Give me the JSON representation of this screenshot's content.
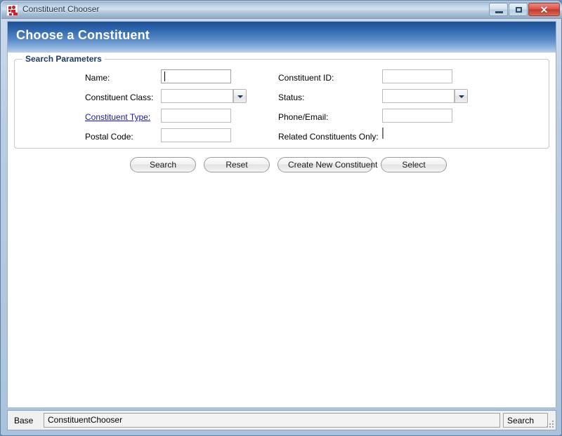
{
  "window": {
    "title": "Constituent Chooser",
    "icon": "app-icon",
    "controls": {
      "minimize": "minimize-icon",
      "maximize": "maximize-icon",
      "close": "✕"
    }
  },
  "header": {
    "title": "Choose a Constituent"
  },
  "group": {
    "legend": "Search Parameters"
  },
  "form": {
    "left": [
      {
        "label": "Name:",
        "type": "text",
        "value": "",
        "focused": true,
        "link": false
      },
      {
        "label": "Constituent Class:",
        "type": "combo",
        "value": "",
        "focused": false,
        "link": false
      },
      {
        "label": "Constituent Type:",
        "type": "text",
        "value": "",
        "focused": false,
        "link": true
      },
      {
        "label": "Postal Code:",
        "type": "text",
        "value": "",
        "focused": false,
        "link": false
      }
    ],
    "right": [
      {
        "label": "Constituent ID:",
        "type": "text",
        "value": "",
        "focused": false,
        "link": false
      },
      {
        "label": "Status:",
        "type": "combo",
        "value": "",
        "focused": false,
        "link": false
      },
      {
        "label": "Phone/Email:",
        "type": "text",
        "value": "",
        "focused": false,
        "link": false
      },
      {
        "label": "Related Constituents Only:",
        "type": "checkbox",
        "value": false,
        "focused": false,
        "link": false
      }
    ]
  },
  "actions": {
    "search": "Search",
    "reset": "Reset",
    "create": "Create New Constituent",
    "select": "Select"
  },
  "statusbar": {
    "label": "Base",
    "path": "ConstituentChooser",
    "button": "Search",
    "grip": "resize-grip-icon"
  },
  "colors": {
    "header_top": "#1d4f96",
    "header_bottom": "#b9d0e9",
    "legend": "#1f3864",
    "link": "#1717a8",
    "frame": "#aac3dc",
    "close_button": "#c0392c"
  }
}
